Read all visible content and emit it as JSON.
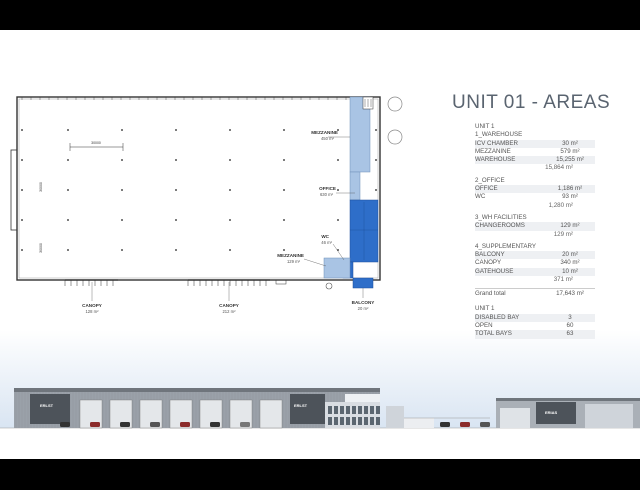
{
  "title": "UNIT 01 - AREAS",
  "plan_labels": {
    "mezzanine_top": {
      "name": "MEZZANINE",
      "area": "450 m²"
    },
    "office": {
      "name": "OFFICE",
      "area": "630 m²"
    },
    "wc": {
      "name": "WC",
      "area": "46 m²"
    },
    "mezzanine_bottom": {
      "name": "MEZZANINE",
      "area": "129 m²"
    },
    "balcony": {
      "name": "BALCONY",
      "area": "20 m²"
    },
    "canopy_left": {
      "name": "CANOPY",
      "area": "128 m²"
    },
    "canopy_right": {
      "name": "CANOPY",
      "area": "212 m²"
    },
    "dim_top": "30000",
    "dim_left_1": "30000",
    "dim_left_2": "30000"
  },
  "areas_table": {
    "unit_label": "UNIT 1",
    "groups": [
      {
        "heading": "1_WAREHOUSE",
        "rows": [
          {
            "label": "ICV CHAMBER",
            "value": "30 m²"
          },
          {
            "label": "MEZZANINE",
            "value": "579 m²"
          },
          {
            "label": "WAREHOUSE",
            "value": "15,255 m²"
          }
        ],
        "total": "15,864 m²"
      },
      {
        "heading": "2_OFFICE",
        "rows": [
          {
            "label": "OFFICE",
            "value": "1,186 m²"
          },
          {
            "label": "WC",
            "value": "93 m²"
          }
        ],
        "total": "1,280 m²"
      },
      {
        "heading": "3_WH FACILITIES",
        "rows": [
          {
            "label": "CHANGEROOMS",
            "value": "129 m²"
          }
        ],
        "total": "129 m²"
      },
      {
        "heading": "4_SUPPLEMENTARY",
        "rows": [
          {
            "label": "BALCONY",
            "value": "20 m²"
          },
          {
            "label": "CANOPY",
            "value": "340 m²"
          },
          {
            "label": "GATEHOUSE",
            "value": "10 m²"
          }
        ],
        "total": "371 m²"
      }
    ],
    "grand_total": {
      "label": "Grand total",
      "value": "17,643 m²"
    }
  },
  "bays_table": {
    "unit_label": "UNIT 1",
    "rows": [
      {
        "label": "DISABLED BAY",
        "value": "3"
      },
      {
        "label": "OPEN",
        "value": "60"
      },
      {
        "label": "TOTAL BAYS",
        "value": "63"
      }
    ]
  },
  "elevation_signs": {
    "left_1": "ERLST",
    "left_2": "ERLST",
    "right": "ERIAS"
  },
  "colors": {
    "office_blue": "#2e6ec9",
    "mezzanine_blue": "#a9c4e4",
    "title_grey": "#5a6470",
    "sky_blue": "#dbe6f3"
  }
}
